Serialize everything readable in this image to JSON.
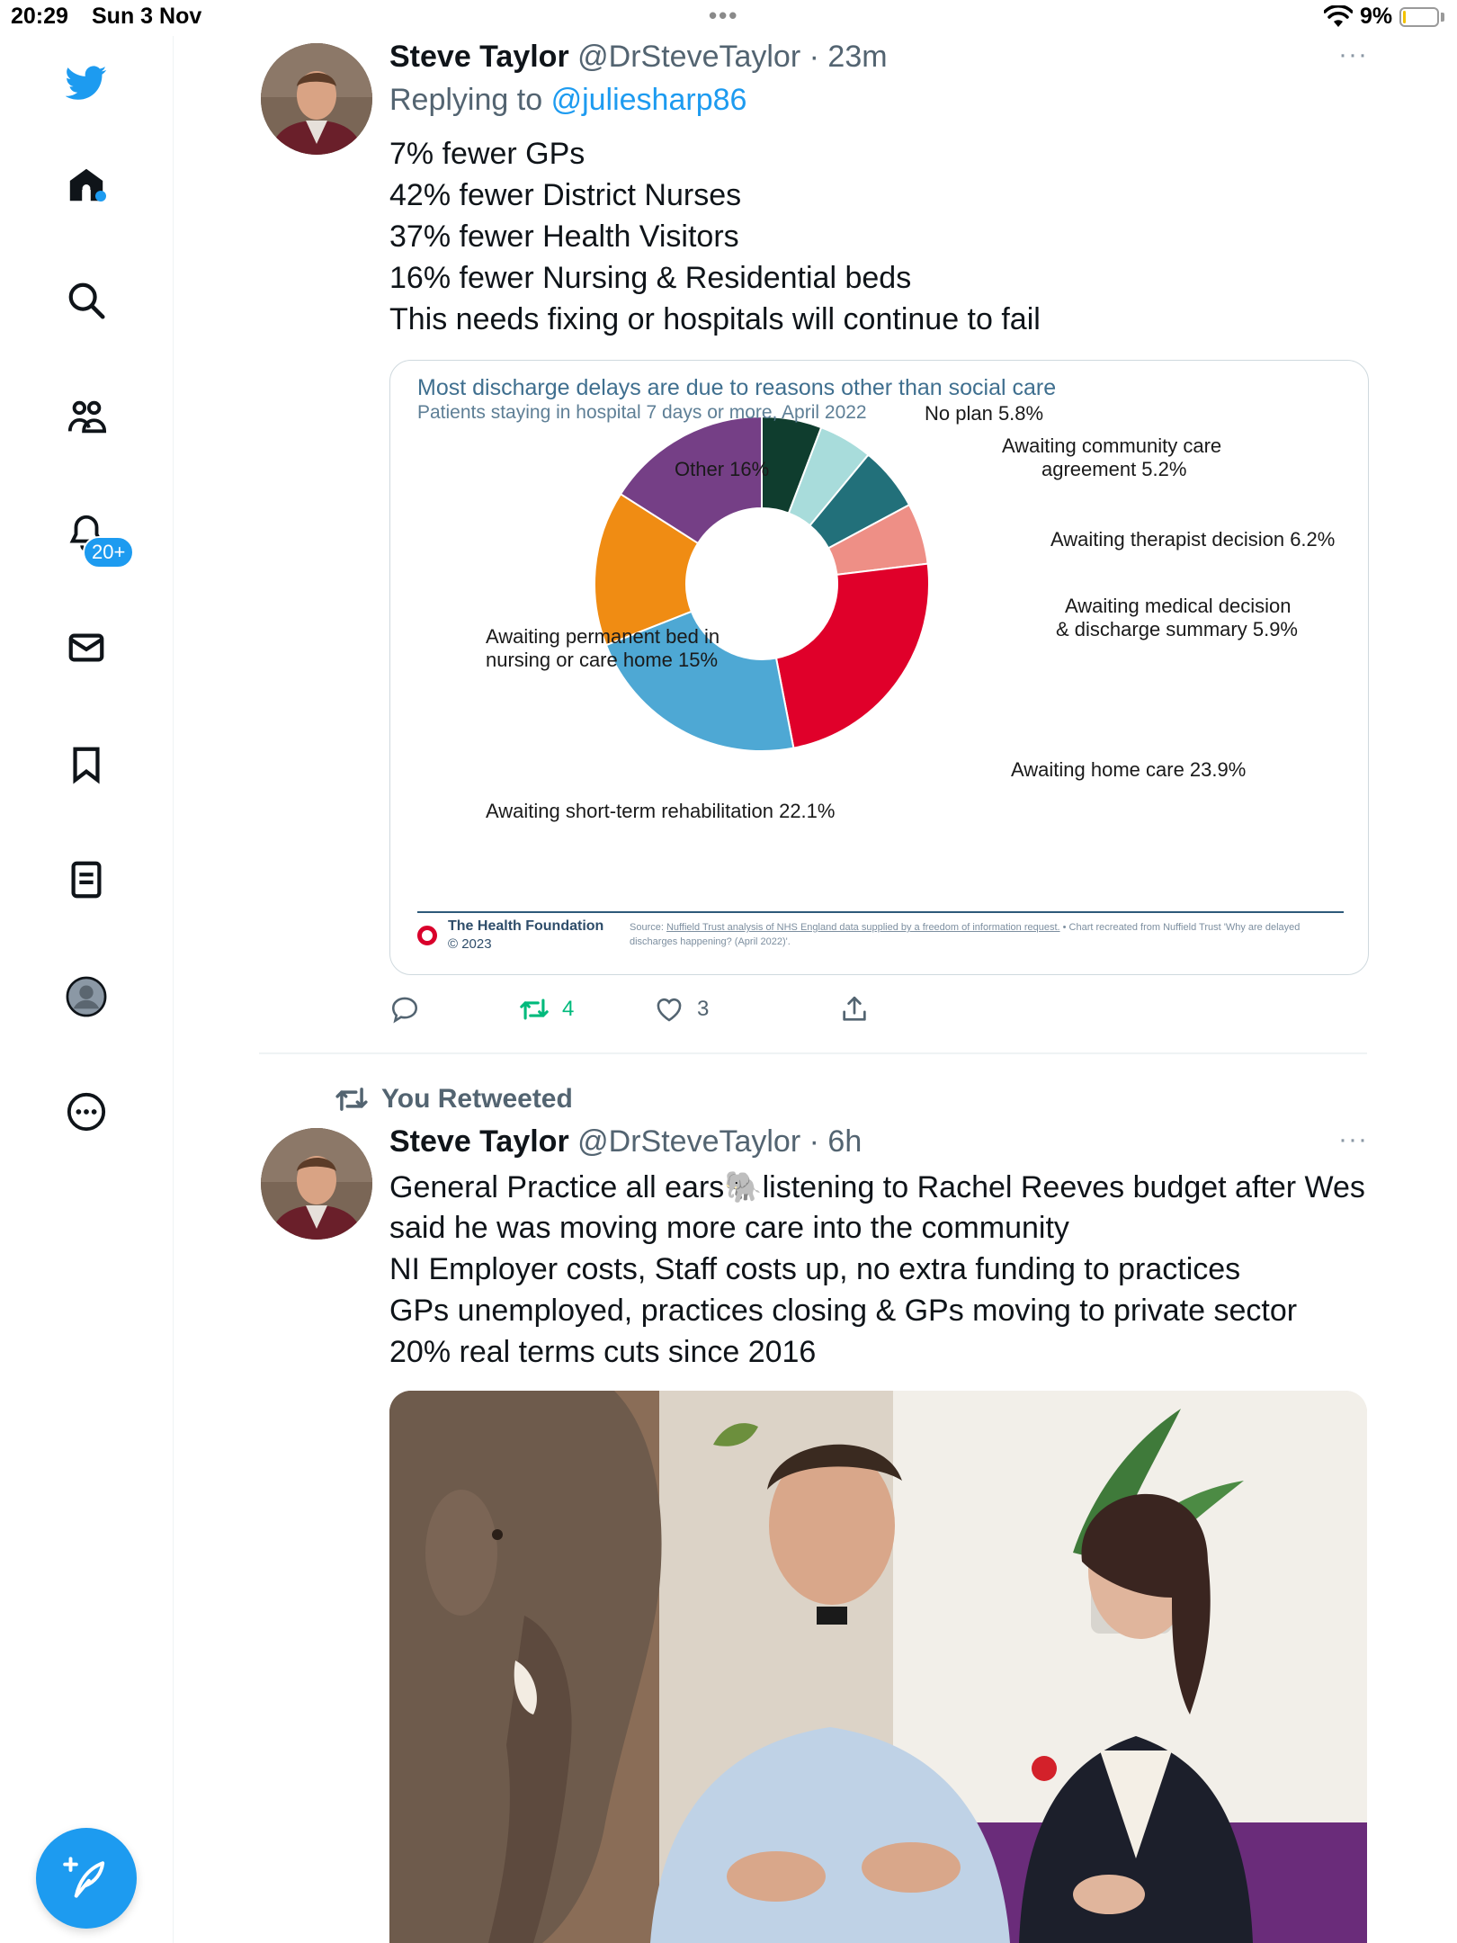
{
  "status_bar": {
    "time": "20:29",
    "date": "Sun 3 Nov",
    "battery_percent": "9%",
    "battery_level": 0.09
  },
  "sidebar": {
    "items": [
      {
        "name": "twitter-logo-icon"
      },
      {
        "name": "home-icon"
      },
      {
        "name": "search-icon"
      },
      {
        "name": "communities-icon"
      },
      {
        "name": "notifications-icon"
      },
      {
        "name": "messages-icon"
      },
      {
        "name": "bookmarks-icon"
      },
      {
        "name": "lists-icon"
      },
      {
        "name": "profile-icon"
      },
      {
        "name": "more-icon"
      }
    ],
    "notifications_badge": "20+",
    "compose_icon": "feather-plus-icon",
    "accent_color": "#1d9bf0"
  },
  "tweet1": {
    "author_name": "Steve Taylor",
    "handle": "@DrSteveTaylor",
    "separator": "·",
    "time": "23m",
    "replying_prefix": "Replying to",
    "replying_to": "@juliesharp86",
    "lines": [
      "7% fewer GPs",
      "42% fewer District Nurses",
      "37% fewer Health Visitors",
      "16% fewer Nursing & Residential beds",
      "This needs fixing or hospitals will continue to fail"
    ],
    "more": "···",
    "actions": {
      "reply_count": "",
      "retweet_count": "4",
      "like_count": "3"
    },
    "retweet_color": "#00ba7c"
  },
  "chart_data": {
    "type": "pie",
    "title": "Most discharge delays are due to reasons other than social care",
    "subtitle": "Patients staying in hospital 7 days or more, April 2022",
    "donut": true,
    "slices": [
      {
        "label": "No plan 5.8%",
        "value": 5.8,
        "color": "#0f3d2e"
      },
      {
        "label": "Awaiting community care agreement 5.2%",
        "value": 5.2,
        "color": "#a8dcdb"
      },
      {
        "label": "Awaiting therapist decision 6.2%",
        "value": 6.2,
        "color": "#22707a"
      },
      {
        "label": "Awaiting medical decision & discharge summary 5.9%",
        "value": 5.9,
        "color": "#ee8f86"
      },
      {
        "label": "Awaiting home care 23.9%",
        "value": 23.9,
        "color": "#e0002a"
      },
      {
        "label": "Awaiting short-term rehabilitation 22.1%",
        "value": 22.1,
        "color": "#4ea8d4"
      },
      {
        "label": "Awaiting permanent bed in nursing or care home 15%",
        "value": 15,
        "color": "#f08c13"
      },
      {
        "label": "Other 16%",
        "value": 16,
        "color": "#753f86"
      }
    ],
    "label_lines": {
      "no_plan": "No plan 5.8%",
      "community_1": "Awaiting community care",
      "community_2": "agreement 5.2%",
      "therapist": "Awaiting therapist decision 6.2%",
      "medical_1": "Awaiting medical decision",
      "medical_2": "& discharge summary 5.9%",
      "home_care": "Awaiting home care 23.9%",
      "rehab": "Awaiting short-term rehabilitation 22.1%",
      "permanent_1": "Awaiting permanent bed in",
      "permanent_2": "nursing or care home 15%",
      "other": "Other 16%"
    },
    "footer": {
      "org": "The Health Foundation",
      "copyright": "© 2023",
      "source_prefix": "Source:",
      "source_link": "Nuffield Trust analysis of NHS England data supplied by a freedom of information request.",
      "source_suffix": "• Chart recreated from Nuffield Trust 'Why are delayed discharges happening? (April 2022)'."
    }
  },
  "retweet_header": {
    "label": "You Retweeted"
  },
  "tweet2": {
    "author_name": "Steve Taylor",
    "handle": "@DrSteveTaylor",
    "separator": "·",
    "time": "6h",
    "more": "···",
    "lines": [
      "General Practice all ears🐘listening to Rachel Reeves budget after Wes",
      "said he was moving more care into the community",
      "NI Employer costs, Staff costs up, no extra funding to practices",
      "GPs unemployed, practices closing & GPs moving to private sector",
      "20% real terms cuts since 2016"
    ]
  }
}
